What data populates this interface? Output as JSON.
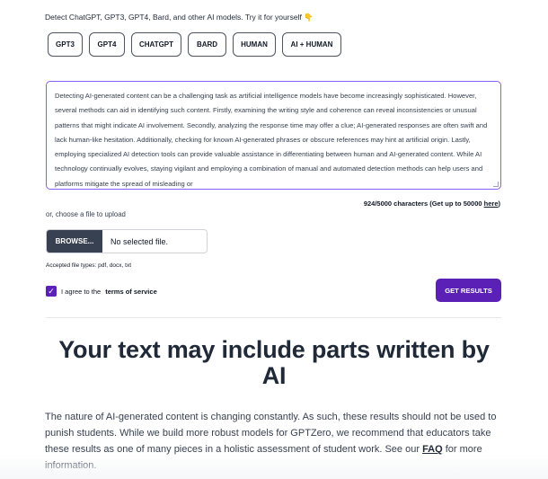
{
  "intro": {
    "text": "Detect ChatGPT, GPT3, GPT4, Bard, and other AI models. Try it for yourself",
    "emoji": "👇"
  },
  "samples": [
    {
      "label": "GPT3"
    },
    {
      "label": "GPT4"
    },
    {
      "label": "CHATGPT"
    },
    {
      "label": "BARD"
    },
    {
      "label": "HUMAN"
    },
    {
      "label": "AI + HUMAN"
    }
  ],
  "textarea": {
    "value": "Detecting AI-generated content can be a challenging task as artificial intelligence models have become increasingly sophisticated. However, several methods can aid in identifying such content. Firstly, examining the writing style and coherence can reveal inconsistencies or unusual patterns that might indicate AI involvement. Secondly, analyzing the response time may offer a clue; AI-generated responses are often swift and lack human-like hesitation. Additionally, checking for known AI-generated phrases or obscure references may hint at artificial origin. Lastly, employing specialized AI detection tools can provide valuable assistance in differentiating between human and AI-generated content. While AI technology continually evolves, staying vigilant and employing a combination of manual and automated detection methods can help users and platforms mitigate the spread of misleading or"
  },
  "counter": {
    "text": "924/5000 characters (Get up to 50000",
    "link": "here",
    "close": ")"
  },
  "upload": {
    "label": "or, choose a file to upload",
    "browse": "BROWSE...",
    "file_status": "No selected file.",
    "types": "Accepted file types: pdf, docx, txt"
  },
  "terms": {
    "checked": true,
    "prefix": "I agree to the",
    "link": "terms of service"
  },
  "submit": {
    "label": "GET RESULTS"
  },
  "result": {
    "headline": "Your text may include parts written by AI",
    "paragraph_before": "The nature of AI-generated content is changing constantly. As such, these results should not be used to punish students. While we build more robust models for GPTZero, we recommend that educators take these results as one of many pieces in a holistic assessment of student work. See our",
    "faq_link": "FAQ",
    "paragraph_after": "for more information."
  },
  "colors": {
    "accent": "#5b21b6",
    "textarea_border": "#8b5cf6",
    "browse_bg": "#374151"
  }
}
